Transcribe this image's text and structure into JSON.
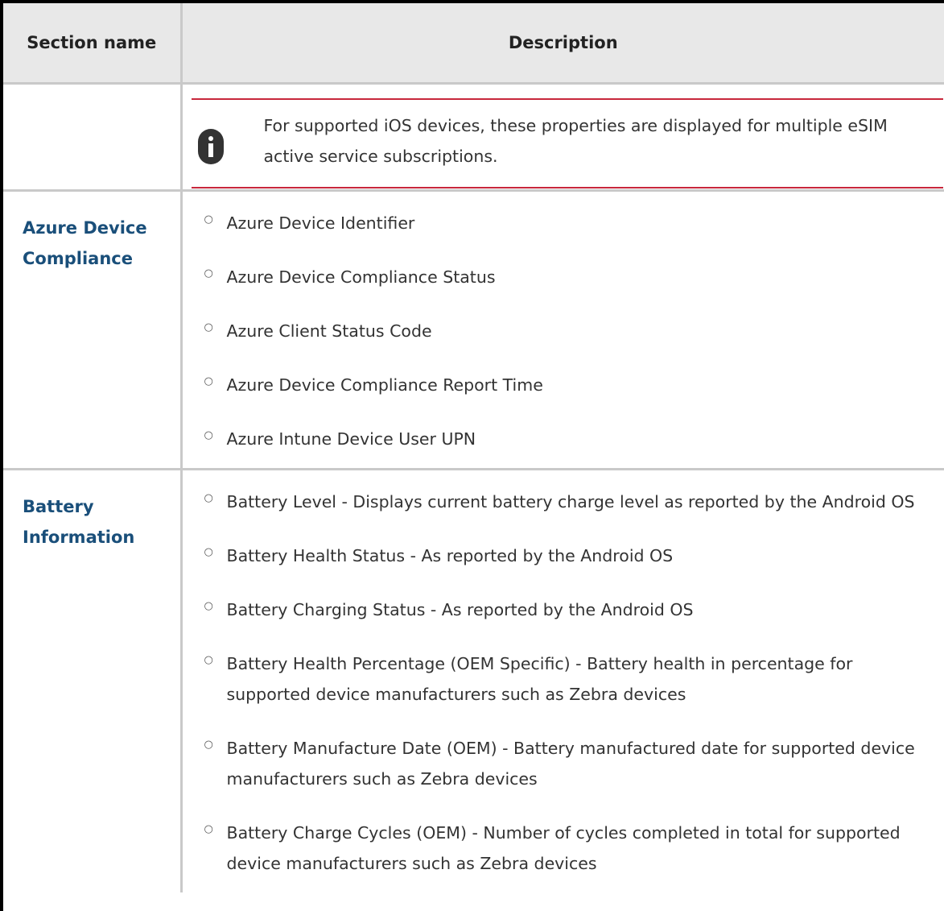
{
  "table": {
    "headers": [
      "Section name",
      "Description"
    ],
    "note": {
      "icon": "info-icon",
      "text": "For supported iOS devices, these properties are displayed for multiple eSIM active service subscriptions.",
      "accent_color": "#c8283c"
    },
    "sections": [
      {
        "name": "Azure Device Compliance",
        "items": [
          "Azure Device Identifier",
          "Azure Device Compliance Status",
          "Azure Client Status Code",
          "Azure Device Compliance Report Time",
          "Azure Intune Device User UPN"
        ]
      },
      {
        "name": "Battery Information",
        "items": [
          "Battery Level - Displays current battery charge level as reported by the Android OS",
          "Battery Health Status - As reported by the Android OS",
          "Battery Charging Status - As reported by the Android OS",
          "Battery Health Percentage (OEM Specific) - Battery health in percentage for supported device manufacturers such as Zebra devices",
          "Battery Manufacture Date (OEM) - Battery manufactured date for supported device manufacturers such as Zebra devices",
          "Battery Charge Cycles (OEM) - Number of cycles completed in total for supported device manufacturers such as Zebra devices"
        ]
      }
    ]
  }
}
